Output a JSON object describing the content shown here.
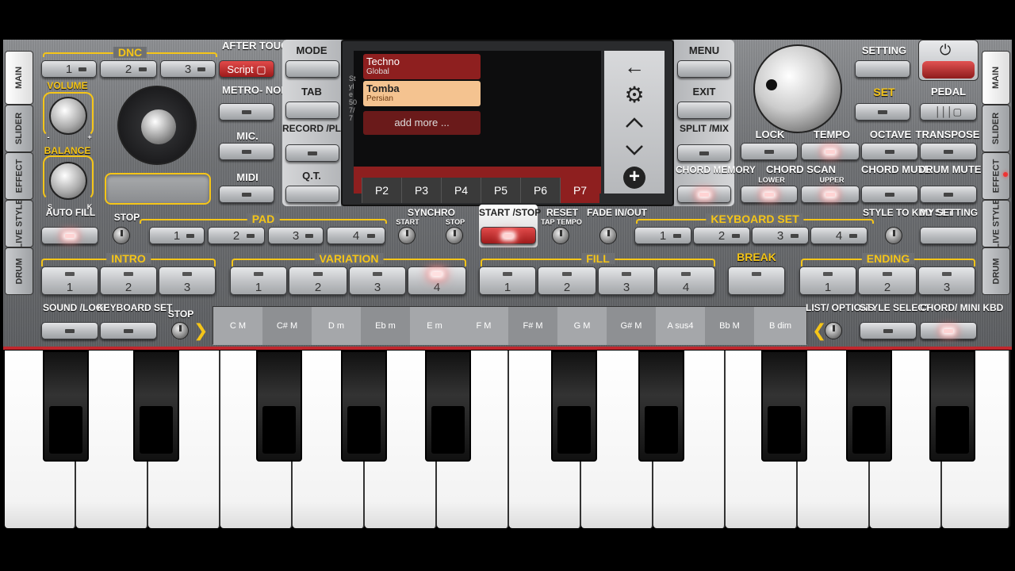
{
  "side_tabs_left": [
    "MAIN",
    "SLIDER",
    "EFFECT",
    "LIVE STYLE",
    "DRUM"
  ],
  "side_tabs_right": [
    "MAIN",
    "SLIDER",
    "EFFECT",
    "LIVE STYLE",
    "DRUM"
  ],
  "dnc": {
    "label": "DNC",
    "b1": "1",
    "b2": "2",
    "b3": "3"
  },
  "after_touch": {
    "label": "AFTER TOUCH",
    "value": "Script"
  },
  "volume": "VOLUME",
  "balance": "BALANCE",
  "balance_minus": "-",
  "balance_plus": "+",
  "balance_s": "S",
  "balance_k": "K",
  "metronome": "METRO- NOME",
  "mic": "MIC.",
  "midi": "MIDI",
  "mode": "MODE",
  "tab": "TAB",
  "record_play": "RECORD /PLAY",
  "qt": "Q.T.",
  "screen": {
    "styles": [
      {
        "name": "Techno",
        "cat": "Global"
      },
      {
        "name": "Tomba",
        "cat": "Persian"
      }
    ],
    "add_more": "add more ...",
    "side_text": "Style 50 7/7",
    "pages": [
      "P2",
      "P3",
      "P4",
      "P5",
      "P6",
      "P7"
    ]
  },
  "menu": "MENU",
  "exit": "EXIT",
  "split_mix": "SPLIT /MIX",
  "chord_memory": "CHORD MEMORY",
  "setting": "SETTING",
  "set": "SET",
  "pedal": "PEDAL",
  "lock": "LOCK",
  "tempo": "TEMPO",
  "octave": "OCTAVE",
  "transpose": "TRANSPOSE",
  "chord_scan": "CHORD SCAN",
  "lower": "LOWER",
  "upper": "UPPER",
  "chord_mute": "CHORD MUTE",
  "drum_mute": "DRUM MUTE",
  "auto_fill": "AUTO FILL",
  "stop": "STOP",
  "pad": {
    "label": "PAD",
    "b": [
      "1",
      "2",
      "3",
      "4"
    ]
  },
  "synchro": {
    "label": "SYNCHRO",
    "start": "START",
    "stop": "STOP"
  },
  "start_stop": "START /STOP",
  "reset": "RESET",
  "tap_tempo": "TAP TEMPO",
  "fade": "FADE IN/OUT",
  "keyboard_set": {
    "label": "KEYBOARD SET",
    "b": [
      "1",
      "2",
      "3",
      "4"
    ]
  },
  "style_to_kbd": "STYLE TO KBD SET",
  "my_setting": "MY SETTING",
  "intro": {
    "label": "INTRO",
    "b": [
      "1",
      "2",
      "3"
    ]
  },
  "variation": {
    "label": "VARIATION",
    "b": [
      "1",
      "2",
      "3",
      "4"
    ]
  },
  "fill": {
    "label": "FILL",
    "b": [
      "1",
      "2",
      "3",
      "4"
    ]
  },
  "break": "BREAK",
  "ending": {
    "label": "ENDING",
    "b": [
      "1",
      "2",
      "3"
    ]
  },
  "sound_loop": "SOUND /LOOP",
  "keyboard_set2": "KEYBOARD SET",
  "stop2": "STOP",
  "chords": [
    "C M",
    "C# M",
    "D m",
    "Eb m",
    "E m",
    "F M",
    "F# M",
    "G M",
    "G# M",
    "A sus4",
    "Bb M",
    "B dim"
  ],
  "list_options": "LIST/ OPTIONS",
  "style_select": "STYLE SELECT",
  "chord_mini_kbd": "CHORD/ MINI KBD",
  "colors": {
    "accent": "#f5c518",
    "red": "#c0272d"
  }
}
